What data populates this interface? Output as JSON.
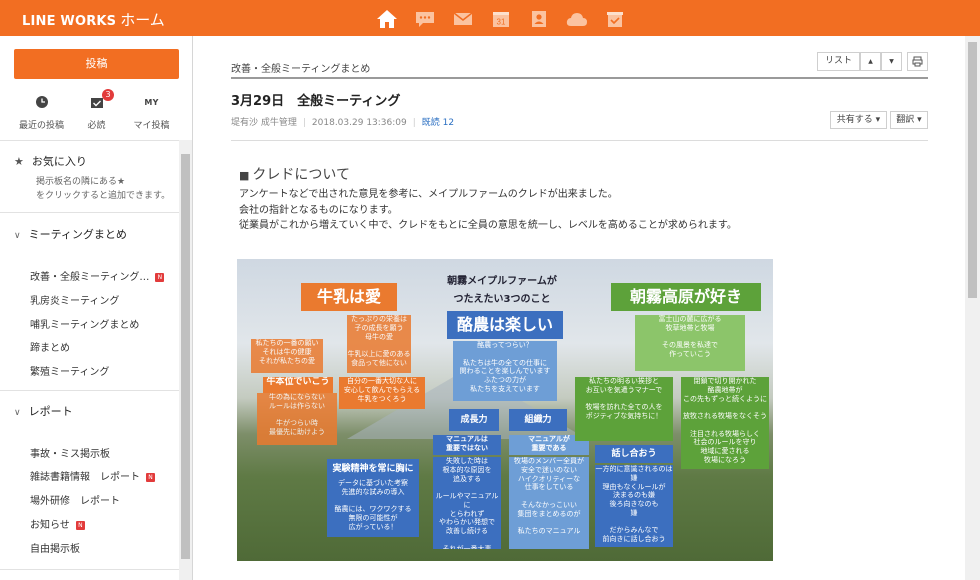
{
  "header": {
    "brand": "LINE WORKS",
    "page": "ホーム",
    "nav_icons": [
      "home-icon",
      "talk-icon",
      "mail-icon",
      "calendar-icon",
      "contacts-icon",
      "drive-icon",
      "board-icon"
    ],
    "calendar_day": "31",
    "accent": "#f26e22"
  },
  "sidebar": {
    "post_button": "投稿",
    "quick": [
      {
        "label": "最近の投稿",
        "icon": "clock-icon"
      },
      {
        "label": "必読",
        "icon": "must-read-icon",
        "badge": "3"
      },
      {
        "label": "マイ投稿",
        "icon": "my-icon",
        "glyph": "MY"
      }
    ],
    "favorites": {
      "title": "お気に入り",
      "help": [
        "掲示板名の隣にある★",
        "をクリックすると追加できます。"
      ]
    },
    "groups": [
      {
        "title": "ミーティングまとめ",
        "items": [
          {
            "label": "改善・全般ミーティング…",
            "new": "N"
          },
          {
            "label": "乳房炎ミーティング"
          },
          {
            "label": "哺乳ミーティングまとめ"
          },
          {
            "label": "蹄まとめ"
          },
          {
            "label": "繁殖ミーティング"
          }
        ]
      },
      {
        "title": "レポート",
        "items": [
          {
            "label": "事故・ミス掲示板"
          },
          {
            "label": "雑誌書籍情報　レポート",
            "new": "N"
          },
          {
            "label": "場外研修　レポート"
          },
          {
            "label": "お知らせ",
            "new": "N"
          },
          {
            "label": "自由掲示板"
          }
        ]
      }
    ]
  },
  "main": {
    "breadcrumb": "改善・全般ミーティングまとめ",
    "toolbar": {
      "list": "リスト",
      "up": "▲",
      "down": "▼",
      "print_icon": "print-icon"
    },
    "post": {
      "title": "3月29日　全般ミーティング",
      "author": "堤有沙 成牛管理",
      "datetime": "2018.03.29 13:36:09",
      "read_label": "既読",
      "read_count": "12",
      "share": "共有する ▾",
      "translate": "翻訳 ▾"
    },
    "content": {
      "section_title": "クレドについて",
      "lines": [
        "アンケートなどで出された意見を参考に、メイプルファームのクレドが出来ました。",
        "会社の指針となるものになります。",
        "従業員がこれから増えていく中で、クレドをもとに全員の意思を統一し、レベルを高めることが求められます。"
      ]
    },
    "poster": {
      "title1": "朝霧メイプルファームが",
      "title2": "つたえたい3つのこと",
      "heads": {
        "milk": "牛乳は愛",
        "dairy": "酪農は楽しい",
        "asagiri": "朝霧高原が好き"
      },
      "subheads": {
        "growth": "成長力",
        "org": "組織力",
        "talk": "話し合おう"
      },
      "boxes": {
        "b1": "私たちの一番の願い\nそれは牛の健康\nそれが私たちの愛",
        "b2": "たっぷりの栄養は\n子の成長を願う\n母牛の愛\n\n牛乳以上に愛のある\n食品って他にない",
        "b3": "牛本位でいこう",
        "b4": "牛の為にならない\nルールは作らない\n\n牛がつらい時\n最優先に助けよう",
        "b5": "自分の一番大切な人に\n安心して飲んでもらえる\n牛乳をつくろう",
        "b6": "酪農ってつらい？\n\n私たちは牛の全ての仕事に\n関わることを楽しんでいます\nふたつの力が\n私たちを支えています",
        "b7": "マニュアルは\n重要ではない",
        "b8": "失敗した時は\n根本的な原因を\n追及する\n\nルールやマニュアルに\nとらわれず\nやわらかい発想で\n改善し続ける\n\nそれが一番大事",
        "b9": "マニュアルが\n重要である",
        "b10": "牧場のメンバー全員が\n安全で迷いのない\nハイクオリティーな\n仕事をしている\n\nそんなかっこいい\n集団をまとめるのが\n\n私たちのマニュアル",
        "b11": "富士山の麓に広がる\n牧草地帯と牧場\n\nその風景を私達で\n作っていこう",
        "b12": "私たちの明るい挨拶と\nお互いを気遣うマナーで\n\n牧場を訪れた全ての人を\nポジティブな気持ちに！",
        "b13": "閉鎖で切り開かれた\n酪農地帯が\nこの先もずっと続くように\n\n放牧される牧場をなくそう\n\n注目される牧場らしく\n社会のルールを守り\n地域に愛される\n牧場になろう",
        "b14": "一方的に意識されるのは\n嫌\n理由もなくルールが\n決まるのも嫌\n後ろ向きなのも\n嫌\n\nだからみんなで\n前向きに話し合おう",
        "b15": "実験精神を常に胸に",
        "b16": "データに基づいた考察\n先進的な試みの導入\n\n酪農には、ワクワクする\n無限の可能性が\n広がっている！"
      }
    }
  }
}
